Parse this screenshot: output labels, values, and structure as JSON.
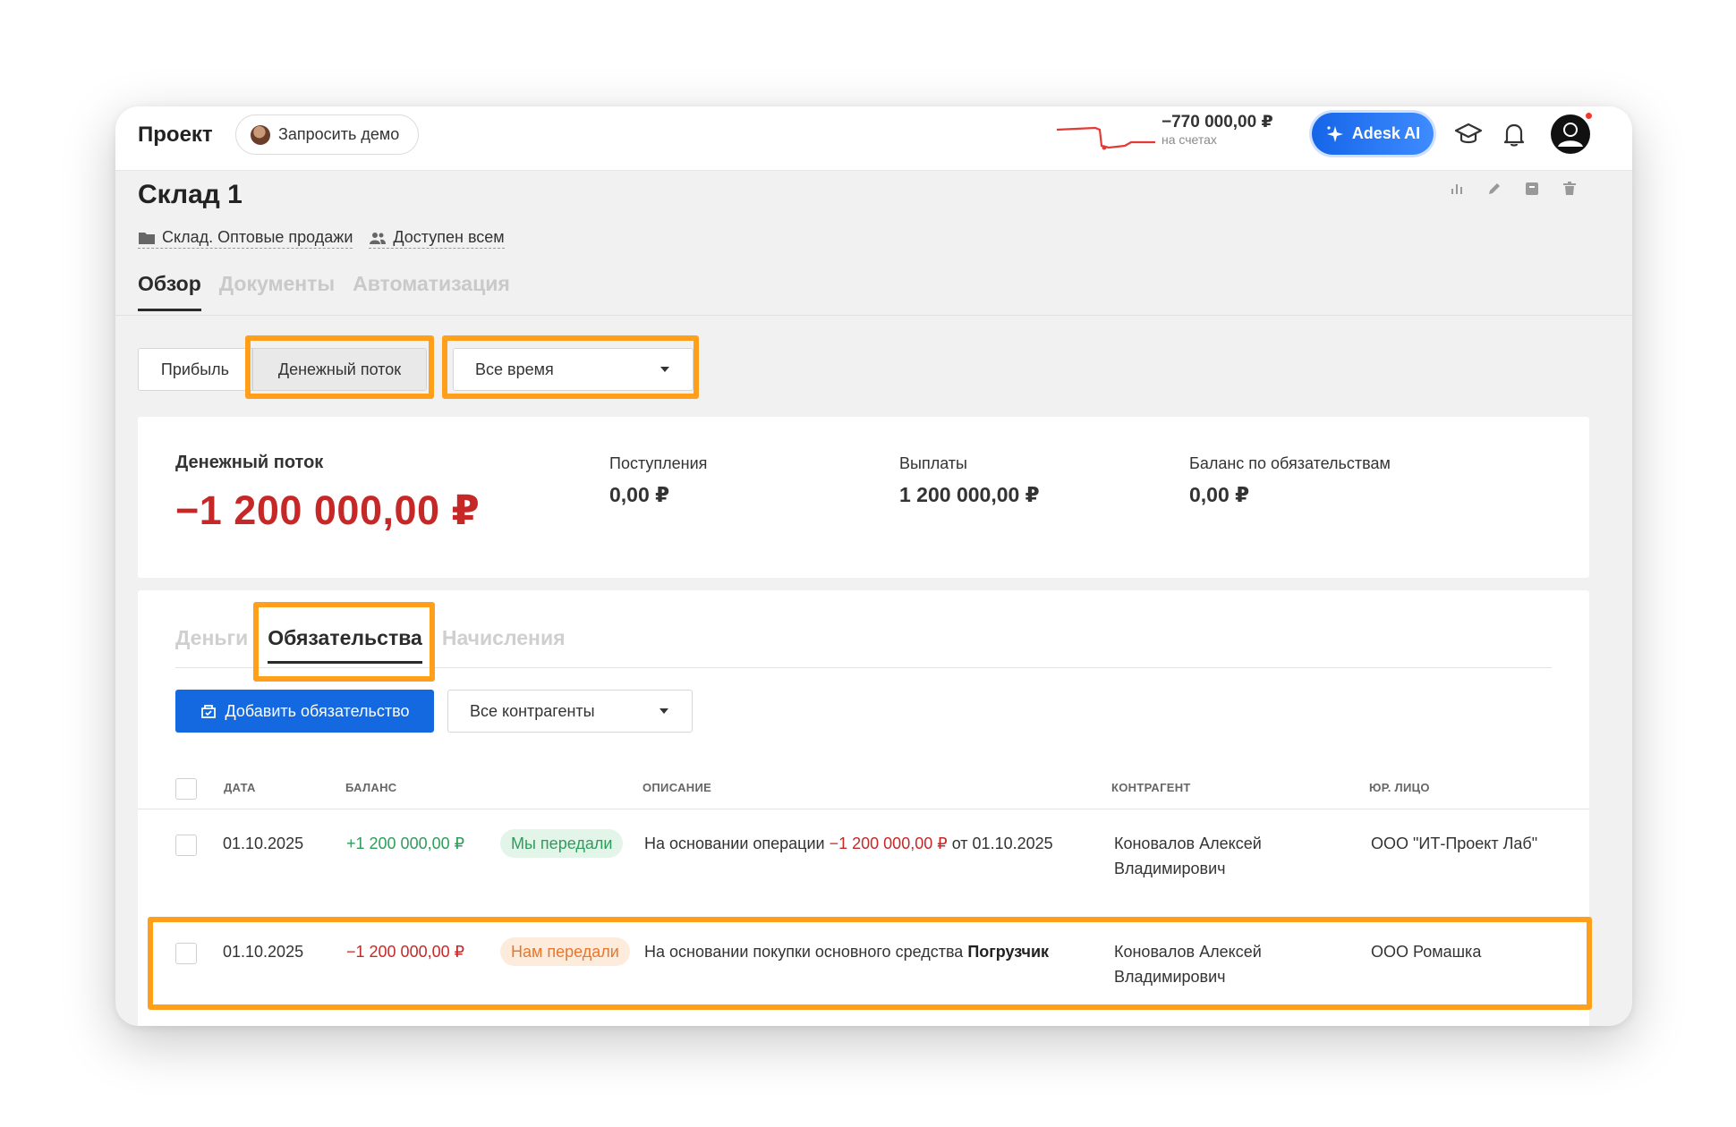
{
  "header": {
    "project": "Проект",
    "demo_button": "Запросить демо",
    "balance_value": "−770 000,00 ₽",
    "balance_caption": "на счетах",
    "ai_button": "Adesk AI"
  },
  "page": {
    "title": "Склад 1",
    "folder": "Склад. Оптовые продажи",
    "access": "Доступен всем",
    "tabs": [
      "Обзор",
      "Документы",
      "Автоматизация"
    ]
  },
  "filters": {
    "profit": "Прибыль",
    "cashflow": "Денежный поток",
    "period": "Все время"
  },
  "summary": {
    "main_label": "Денежный поток",
    "main_value": "−1 200 000,00 ₽",
    "receipts_label": "Поступления",
    "receipts_value": "0,00 ₽",
    "payments_label": "Выплаты",
    "payments_value": "1 200 000,00 ₽",
    "liabilities_label": "Баланс по обязательствам",
    "liabilities_value": "0,00 ₽"
  },
  "obligations": {
    "tabs": [
      "Деньги",
      "Обязательства",
      "Начисления"
    ],
    "add_button": "Добавить обязательство",
    "counterparty_filter": "Все контрагенты",
    "columns": [
      "ДАТА",
      "БАЛАНС",
      "ОПИСАНИЕ",
      "КОНТРАГЕНТ",
      "ЮР. ЛИЦО"
    ],
    "rows": [
      {
        "date": "01.10.2025",
        "balance": "+1 200 000,00 ₽",
        "badge": "Мы передали",
        "desc_prefix": "На основании операции ",
        "desc_amount": "−1 200 000,00 ₽",
        "desc_suffix": " от 01.10.2025",
        "counterparty_line1": "Коновалов Алексей",
        "counterparty_line2": "Владимирович",
        "entity": "ООО \"ИТ-Проект Лаб\""
      },
      {
        "date": "01.10.2025",
        "balance": "−1 200 000,00 ₽",
        "badge": "Нам передали",
        "desc_prefix": "На основании покупки основного средства ",
        "desc_bold": "Погрузчик",
        "counterparty_line1": "Коновалов Алексей",
        "counterparty_line2": "Владимирович",
        "entity": "ООО Ромашка"
      }
    ]
  },
  "colors": {
    "accent": "#1468e0",
    "negative": "#c62828",
    "positive": "#2e9d5b",
    "highlight": "#ff9f1a"
  }
}
